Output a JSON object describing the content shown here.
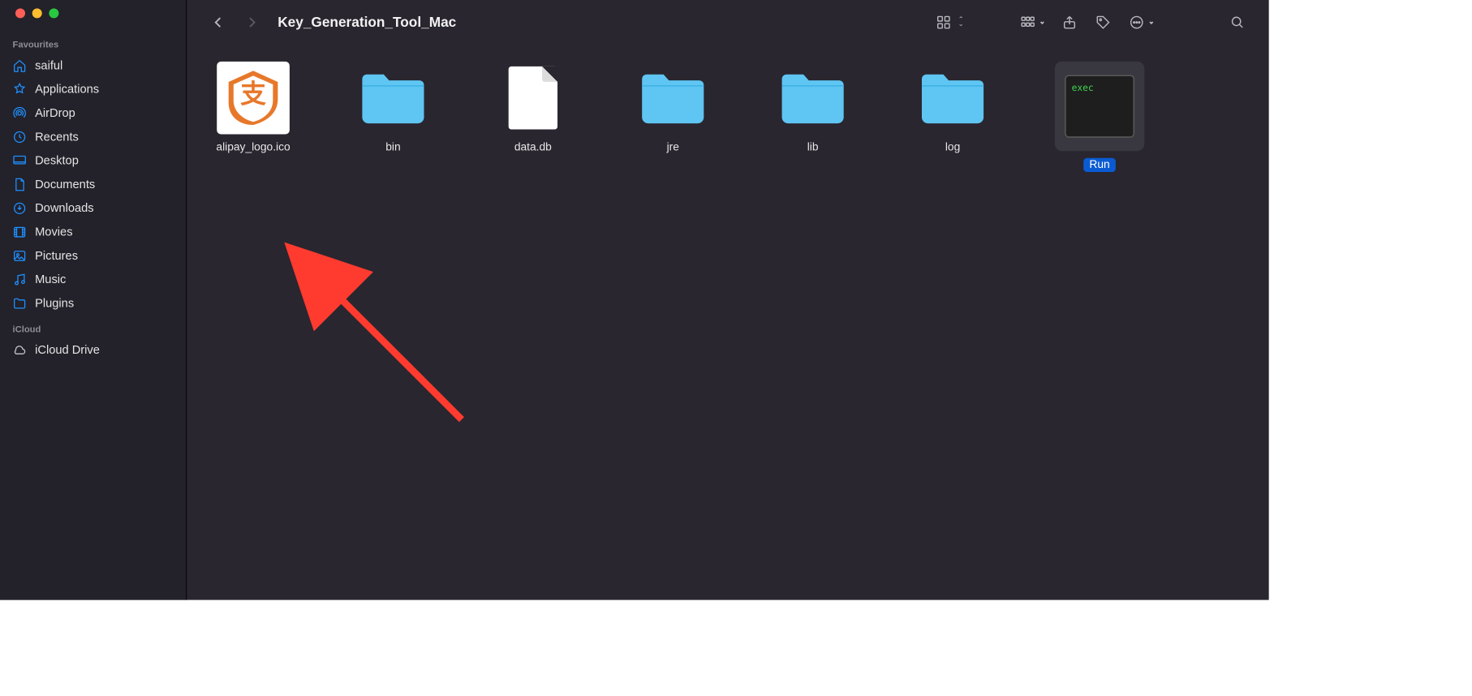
{
  "window": {
    "title": "Key_Generation_Tool_Mac"
  },
  "sidebar": {
    "sections": {
      "favourites": {
        "title": "Favourites",
        "items": [
          {
            "label": "saiful",
            "icon": "home-icon"
          },
          {
            "label": "Applications",
            "icon": "app-icon"
          },
          {
            "label": "AirDrop",
            "icon": "airdrop-icon"
          },
          {
            "label": "Recents",
            "icon": "clock-icon"
          },
          {
            "label": "Desktop",
            "icon": "desktop-icon"
          },
          {
            "label": "Documents",
            "icon": "document-icon"
          },
          {
            "label": "Downloads",
            "icon": "download-icon"
          },
          {
            "label": "Movies",
            "icon": "film-icon"
          },
          {
            "label": "Pictures",
            "icon": "picture-icon"
          },
          {
            "label": "Music",
            "icon": "music-icon"
          },
          {
            "label": "Plugins",
            "icon": "folder-icon"
          }
        ]
      },
      "icloud": {
        "title": "iCloud",
        "items": [
          {
            "label": "iCloud Drive",
            "icon": "cloud-icon"
          }
        ]
      }
    }
  },
  "files": [
    {
      "name": "alipay_logo.ico",
      "kind": "ico",
      "selected": false
    },
    {
      "name": "bin",
      "kind": "folder",
      "selected": false
    },
    {
      "name": "data.db",
      "kind": "file",
      "selected": false
    },
    {
      "name": "jre",
      "kind": "folder",
      "selected": false
    },
    {
      "name": "lib",
      "kind": "folder",
      "selected": false
    },
    {
      "name": "log",
      "kind": "folder",
      "selected": false
    },
    {
      "name": "Run",
      "kind": "exec",
      "selected": true,
      "exec_label": "exec"
    }
  ],
  "annotation": {
    "type": "arrow",
    "color": "#ff3b30",
    "target": "Run"
  }
}
